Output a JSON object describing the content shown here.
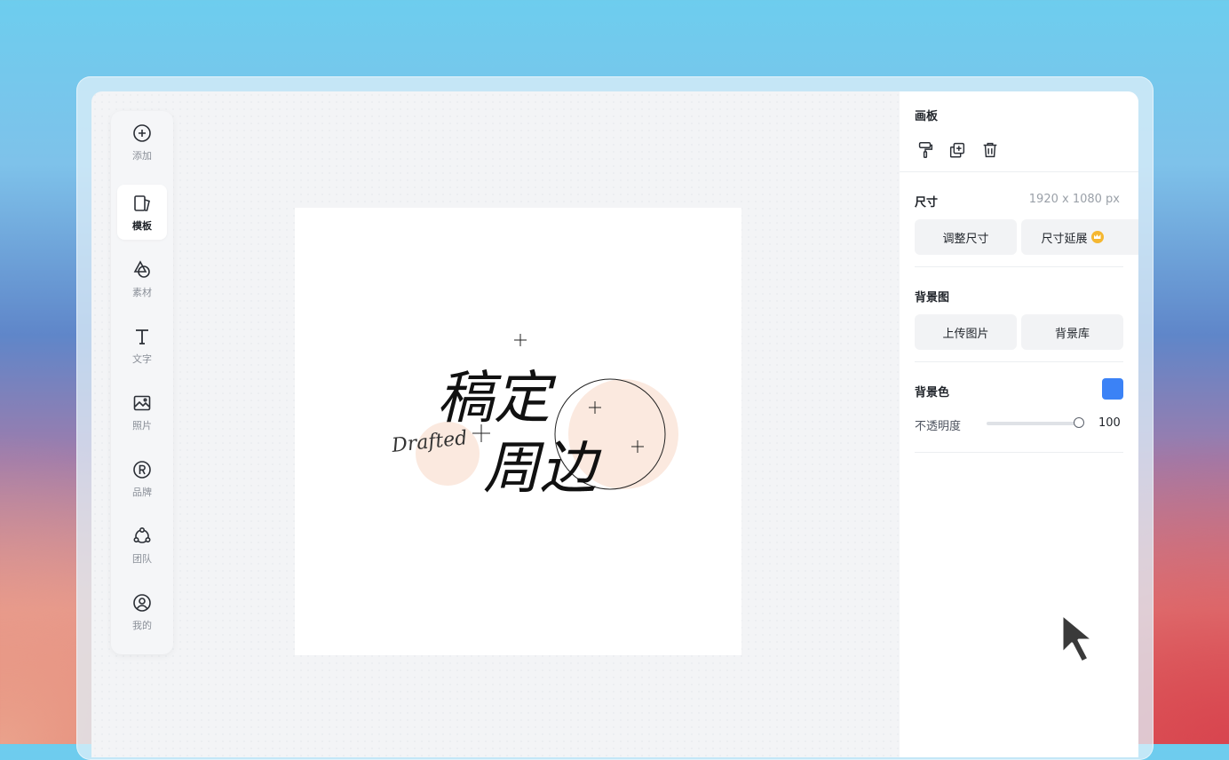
{
  "sidebar": {
    "items": [
      {
        "label": "添加",
        "icon": "plus-circle-icon"
      },
      {
        "label": "模板",
        "icon": "template-icon"
      },
      {
        "label": "素材",
        "icon": "shapes-icon"
      },
      {
        "label": "文字",
        "icon": "text-icon"
      },
      {
        "label": "照片",
        "icon": "image-icon"
      },
      {
        "label": "品牌",
        "icon": "registered-icon"
      },
      {
        "label": "团队",
        "icon": "team-icon"
      },
      {
        "label": "我的",
        "icon": "user-circle-icon"
      }
    ],
    "active_index": 1
  },
  "canvas": {
    "title_line1": "稿定",
    "title_line2": "周边",
    "script_text": "Drafted",
    "accent_color": "#fbe9df"
  },
  "panel": {
    "artboard_title": "画板",
    "tools": [
      "format-painter-icon",
      "duplicate-icon",
      "trash-icon"
    ],
    "size_title": "尺寸",
    "size_value": "1920 x 1080 px",
    "resize_button": "调整尺寸",
    "extend_button": "尺寸延展",
    "bg_image_title": "背景图",
    "upload_button": "上传图片",
    "library_button": "背景库",
    "bg_color_title": "背景色",
    "bg_color": "#3b82f6",
    "opacity_label": "不透明度",
    "opacity_value": "100",
    "opacity_fraction": 1.0
  }
}
